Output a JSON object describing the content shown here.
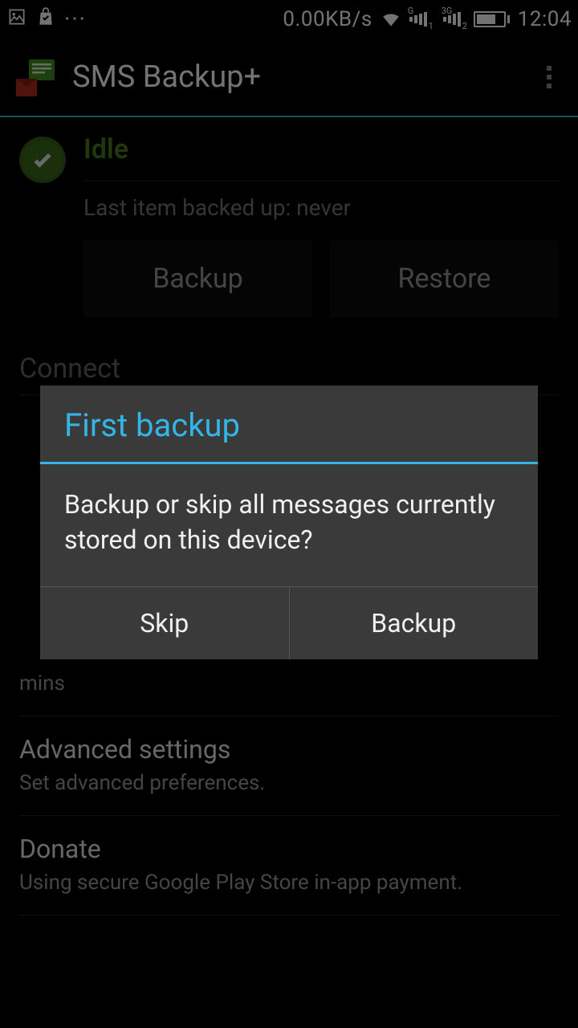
{
  "status_bar": {
    "net_speed": "0.00KB/s",
    "sim1_sup": "G",
    "sim1_sub": "1",
    "sim2_sup": "3G",
    "sim2_sub": "2",
    "time": "12:04"
  },
  "header": {
    "title": "SMS Backup+"
  },
  "status": {
    "state": "Idle",
    "last_line": "Last item backed up: never",
    "backup_label": "Backup",
    "restore_label": "Restore"
  },
  "connect_header": "Connect",
  "rows": {
    "mins": "mins",
    "advanced_title": "Advanced settings",
    "advanced_sub": "Set advanced preferences.",
    "donate_title": "Donate",
    "donate_sub": "Using secure Google Play Store in-app payment."
  },
  "dialog": {
    "title": "First backup",
    "body": "Backup or skip all messages currently stored on this device?",
    "skip": "Skip",
    "backup": "Backup"
  }
}
